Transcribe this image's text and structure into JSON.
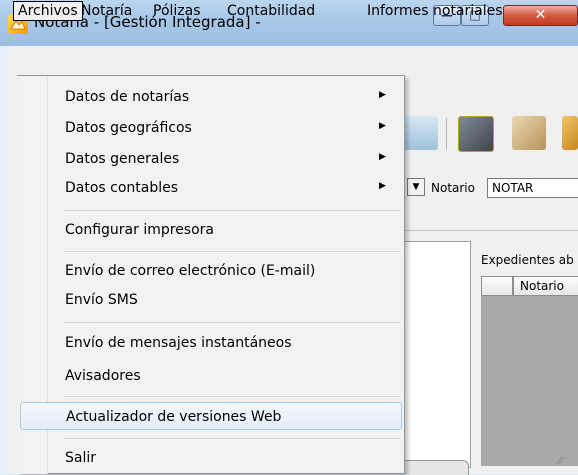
{
  "window": {
    "title": "Notaria - [Gestión Integrada] -",
    "controls": {
      "minimize": "—",
      "maximize": "□",
      "close": "✕"
    }
  },
  "menubar": [
    "Archivos",
    "Notaría",
    "Pólizas",
    "Contabilidad",
    "Informes notariales"
  ],
  "archivos_menu": {
    "items": [
      {
        "label": "Datos de notarías",
        "submenu": true
      },
      {
        "label": "Datos geográficos",
        "submenu": true
      },
      {
        "label": "Datos generales",
        "submenu": true
      },
      {
        "label": "Datos contables",
        "submenu": true
      },
      {
        "label": "Configurar impresora"
      },
      {
        "label": "Envío de correo electrónico (E-mail)"
      },
      {
        "label": "Envío SMS"
      },
      {
        "label": "Envío de mensajes instantáneos"
      },
      {
        "label": "Avisadores"
      },
      {
        "label": "Actualizador de versiones Web",
        "highlighted": true
      },
      {
        "label": "Salir"
      }
    ],
    "submenu_arrow": "▶"
  },
  "toolbar": {
    "notario_label": "Notario",
    "notario_value": "NOTAR",
    "combo_arrow": "▼"
  },
  "panel": {
    "group_label": "Expedientes ab",
    "column_header": "Notario"
  },
  "colors": {
    "highlight_border": "#a8cbe8",
    "close_button": "#c23a22",
    "titlebar": "#a9c8e7"
  }
}
